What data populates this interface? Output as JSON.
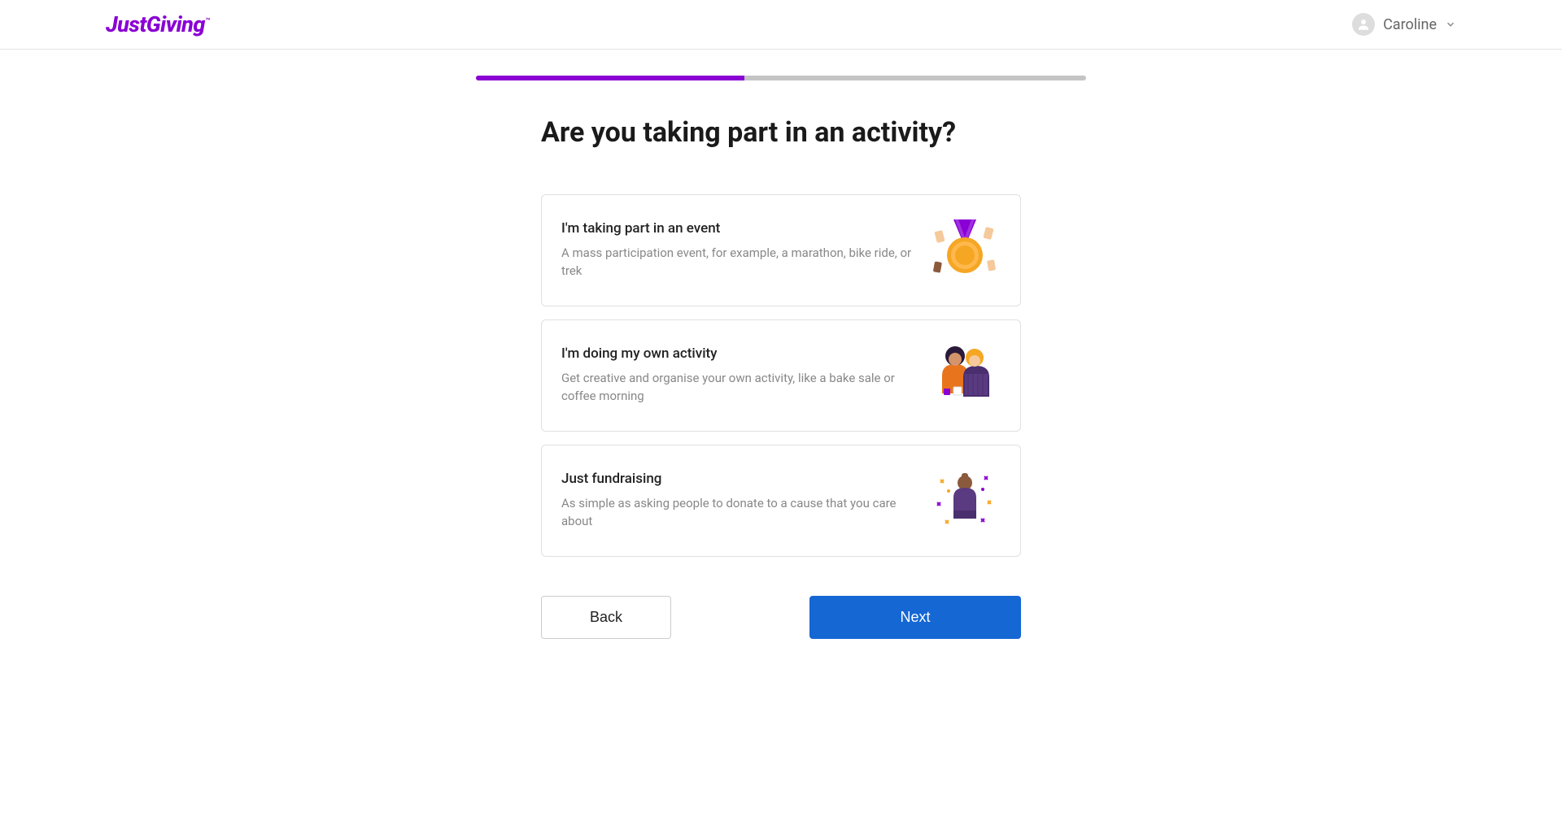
{
  "header": {
    "logo_text": "JustGiving",
    "user_name": "Caroline"
  },
  "progress": {
    "percent": 44
  },
  "page": {
    "heading": "Are you taking part in an activity?"
  },
  "options": [
    {
      "title": "I'm taking part in an event",
      "description": "A mass participation event, for example, a marathon, bike ride, or trek"
    },
    {
      "title": "I'm doing my own activity",
      "description": "Get creative and organise your own activity, like a bake sale or coffee morning"
    },
    {
      "title": "Just fundraising",
      "description": "As simple as asking people to donate to a cause that you care about"
    }
  ],
  "buttons": {
    "back": "Back",
    "next": "Next"
  }
}
